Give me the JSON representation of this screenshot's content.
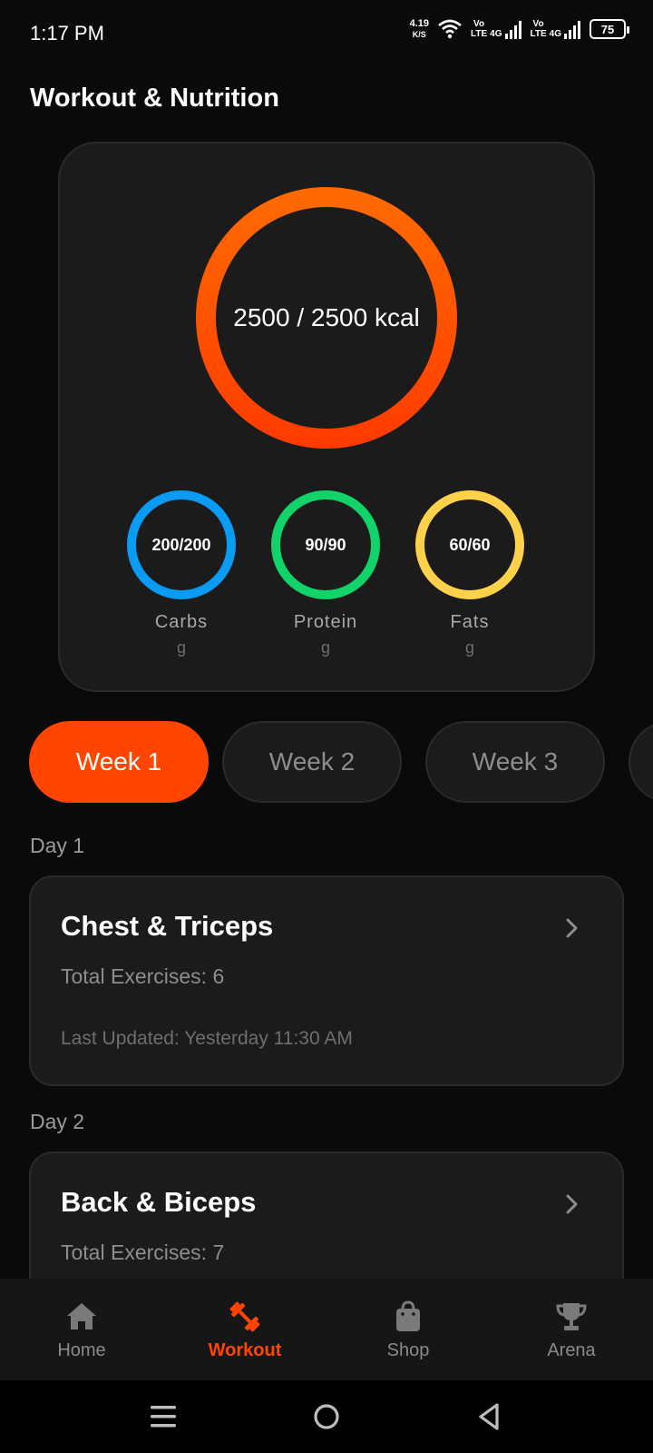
{
  "status_bar": {
    "time": "1:17 PM",
    "net_speed": "4.19",
    "net_unit": "K/S",
    "sim1_top": "Vo",
    "sim1_bottom": "LTE",
    "sim1_type": "4G",
    "sim2_top": "Vo",
    "sim2_bottom": "LTE",
    "sim2_type": "4G",
    "battery": "75"
  },
  "page_title": "Workout & Nutrition",
  "nutrition": {
    "calories_text": "2500 / 2500 kcal",
    "calories_progress": 1.0,
    "macros": [
      {
        "value": "200/200",
        "label": "Carbs",
        "unit": "g",
        "color": "#0a9cf5"
      },
      {
        "value": "90/90",
        "label": "Protein",
        "unit": "g",
        "color": "#11d36a"
      },
      {
        "value": "60/60",
        "label": "Fats",
        "unit": "g",
        "color": "#ffd04a"
      }
    ],
    "ring_gradient": [
      "#ff3c00",
      "#ff6a00"
    ]
  },
  "weeks": [
    {
      "label": "Week 1",
      "active": true
    },
    {
      "label": "Week 2",
      "active": false
    },
    {
      "label": "Week 3",
      "active": false
    }
  ],
  "days": [
    {
      "label": "Day 1",
      "title": "Chest & Triceps",
      "exercises": "Total Exercises: 6",
      "updated": "Last Updated: Yesterday 11:30 AM"
    },
    {
      "label": "Day 2",
      "title": "Back & Biceps",
      "exercises": "Total Exercises: 7"
    }
  ],
  "nav": [
    {
      "label": "Home",
      "icon": "home-icon",
      "active": false
    },
    {
      "label": "Workout",
      "icon": "dumbbell-icon",
      "active": true
    },
    {
      "label": "Shop",
      "icon": "shopping-bag-icon",
      "active": false
    },
    {
      "label": "Arena",
      "icon": "trophy-icon",
      "active": false
    }
  ],
  "accent_color": "#ff4500"
}
